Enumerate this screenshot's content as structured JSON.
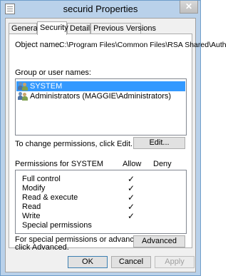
{
  "window": {
    "title": "securid Properties",
    "close_glyph": "✕"
  },
  "tabs": [
    {
      "label": "General"
    },
    {
      "label": "Security"
    },
    {
      "label": "Details"
    },
    {
      "label": "Previous Versions"
    }
  ],
  "security": {
    "object_name_label": "Object name:",
    "object_name_value": "C:\\Program Files\\Common Files\\RSA Shared\\Auth",
    "group_label": "Group or user names:",
    "users": [
      {
        "name": "SYSTEM",
        "icon": "users-icon",
        "selected": true
      },
      {
        "name": "Administrators (MAGGIE\\Administrators)",
        "icon": "users-icon",
        "selected": false
      }
    ],
    "change_text": "To change permissions, click Edit.",
    "edit_label": "Edit...",
    "permissions_header": "Permissions for SYSTEM",
    "allow_header": "Allow",
    "deny_header": "Deny",
    "permissions": [
      {
        "name": "Full control",
        "allow": true,
        "deny": false
      },
      {
        "name": "Modify",
        "allow": true,
        "deny": false
      },
      {
        "name": "Read & execute",
        "allow": true,
        "deny": false
      },
      {
        "name": "Read",
        "allow": true,
        "deny": false
      },
      {
        "name": "Write",
        "allow": true,
        "deny": false
      },
      {
        "name": "Special permissions",
        "allow": false,
        "deny": false
      }
    ],
    "check_glyph": "✓",
    "advanced_text_1": "For special permissions or advanced settings,",
    "advanced_text_2": "click Advanced.",
    "advanced_label": "Advanced"
  },
  "footer": {
    "ok_label": "OK",
    "cancel_label": "Cancel",
    "apply_label": "Apply"
  }
}
